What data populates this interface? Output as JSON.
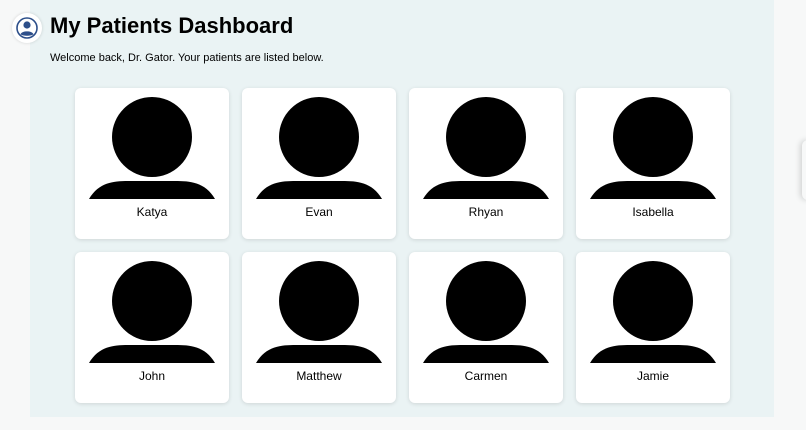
{
  "header": {
    "logo_icon": "user-circle-icon",
    "title": "My Patients Dashboard",
    "subtitle": "Welcome back, Dr. Gator. Your patients are listed below."
  },
  "colors": {
    "panel_background": "#eaf3f4",
    "logo_accent": "#2d4f8a",
    "avatar_fill": "#000000"
  },
  "patients": [
    {
      "name": "Katya",
      "avatar_icon": "person-silhouette-icon"
    },
    {
      "name": "Evan",
      "avatar_icon": "person-silhouette-icon"
    },
    {
      "name": "Rhyan",
      "avatar_icon": "person-silhouette-icon"
    },
    {
      "name": "Isabella",
      "avatar_icon": "person-silhouette-icon"
    },
    {
      "name": "John",
      "avatar_icon": "person-silhouette-icon"
    },
    {
      "name": "Matthew",
      "avatar_icon": "person-silhouette-icon"
    },
    {
      "name": "Carmen",
      "avatar_icon": "person-silhouette-icon"
    },
    {
      "name": "Jamie",
      "avatar_icon": "person-silhouette-icon"
    }
  ]
}
